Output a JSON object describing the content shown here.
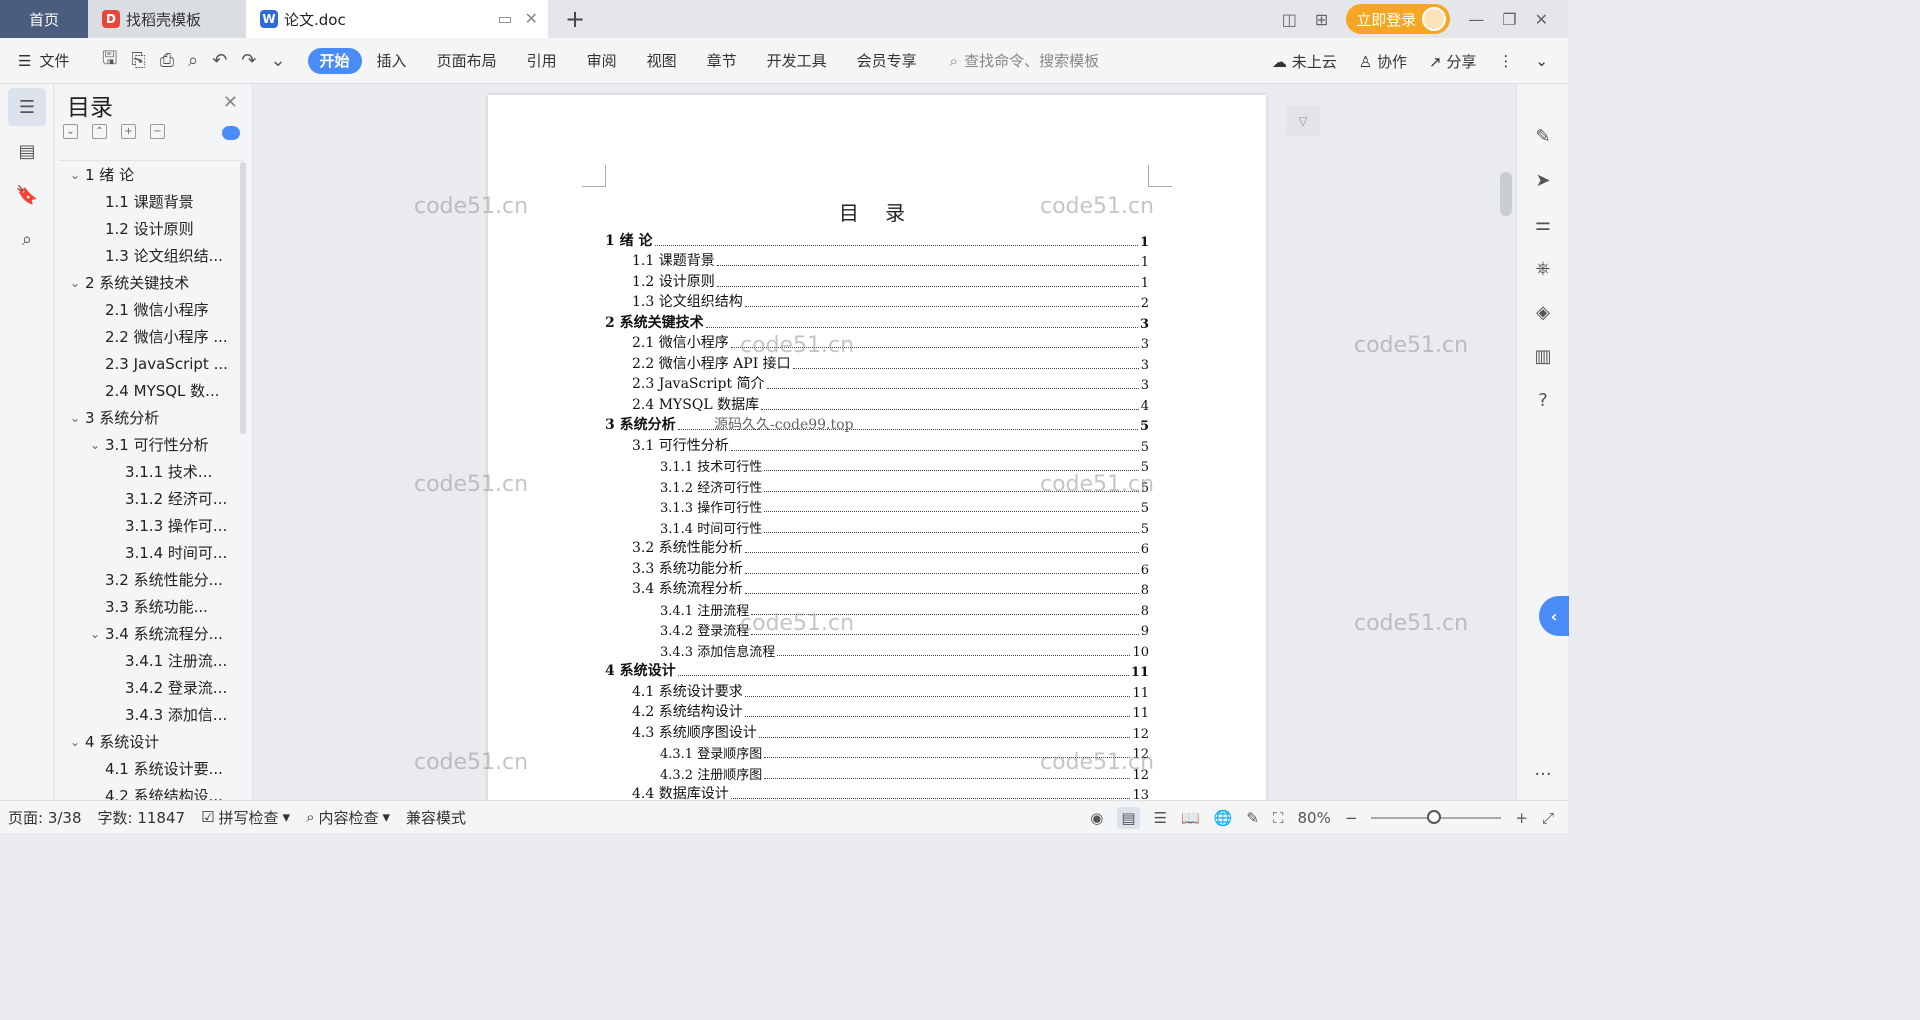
{
  "titlebar": {
    "tabs": [
      {
        "label": "首页"
      },
      {
        "label": "找稻壳模板"
      },
      {
        "label": "论文.doc"
      }
    ],
    "new_tab": "+",
    "login_label": "立即登录"
  },
  "toolbar": {
    "file_label": "文件",
    "tabs": [
      "开始",
      "插入",
      "页面布局",
      "引用",
      "审阅",
      "视图",
      "章节",
      "开发工具",
      "会员专享"
    ],
    "search_placeholder": "查找命令、搜索模板",
    "cloud_label": "未上云",
    "collab_label": "协作",
    "share_label": "分享"
  },
  "toc_panel": {
    "title": "目录",
    "items": [
      {
        "label": "1 绪  论",
        "level": 1,
        "expand": true
      },
      {
        "label": "1.1 课题背景",
        "level": 2
      },
      {
        "label": "1.2 设计原则",
        "level": 2
      },
      {
        "label": "1.3 论文组织结...",
        "level": 2
      },
      {
        "label": "2 系统关键技术",
        "level": 1,
        "expand": true
      },
      {
        "label": "2.1 微信小程序",
        "level": 2
      },
      {
        "label": "2.2 微信小程序 ...",
        "level": 2
      },
      {
        "label": "2.3 JavaScript ...",
        "level": 2
      },
      {
        "label": "2.4 MYSQL 数...",
        "level": 2
      },
      {
        "label": "3 系统分析",
        "level": 1,
        "expand": true
      },
      {
        "label": "3.1 可行性分析",
        "level": 2,
        "expand": true
      },
      {
        "label": "3.1.1  技术...",
        "level": 3
      },
      {
        "label": "3.1.2 经济可...",
        "level": 3
      },
      {
        "label": "3.1.3 操作可...",
        "level": 3
      },
      {
        "label": "3.1.4 时间可...",
        "level": 3
      },
      {
        "label": "3.2 系统性能分...",
        "level": 2
      },
      {
        "label": "3.3   系统功能...",
        "level": 2
      },
      {
        "label": "3.4 系统流程分...",
        "level": 2,
        "expand": true
      },
      {
        "label": "3.4.1 注册流...",
        "level": 3
      },
      {
        "label": "3.4.2 登录流...",
        "level": 3
      },
      {
        "label": "3.4.3 添加信...",
        "level": 3
      },
      {
        "label": "4 系统设计",
        "level": 1,
        "expand": true
      },
      {
        "label": "4.1 系统设计要...",
        "level": 2
      },
      {
        "label": "4.2 系统结构设...",
        "level": 2
      }
    ]
  },
  "document": {
    "title": "目  录",
    "entries": [
      {
        "label": "1 绪  论",
        "page": "1",
        "level": 1
      },
      {
        "label": "1.1 课题背景",
        "page": "1",
        "level": 2
      },
      {
        "label": "1.2 设计原则",
        "page": "1",
        "level": 2
      },
      {
        "label": "1.3 论文组织结构",
        "page": "2",
        "level": 2
      },
      {
        "label": "2 系统关键技术",
        "page": "3",
        "level": 1
      },
      {
        "label": "2.1 微信小程序",
        "page": "3",
        "level": 2
      },
      {
        "label": "2.2 微信小程序 API 接口",
        "page": "3",
        "level": 2
      },
      {
        "label": "2.3  JavaScript 简介",
        "page": "3",
        "level": 2
      },
      {
        "label": "2.4  MYSQL 数据库",
        "page": "4",
        "level": 2
      },
      {
        "label": "3 系统分析",
        "page": "5",
        "level": 1
      },
      {
        "label": "3.1 可行性分析",
        "page": "5",
        "level": 2
      },
      {
        "label": "3.1.1  技术可行性",
        "page": "5",
        "level": 3
      },
      {
        "label": "3.1.2 经济可行性",
        "page": "5",
        "level": 3
      },
      {
        "label": "3.1.3 操作可行性",
        "page": "5",
        "level": 3
      },
      {
        "label": "3.1.4 时间可行性",
        "page": "5",
        "level": 3
      },
      {
        "label": "3.2 系统性能分析",
        "page": "6",
        "level": 2
      },
      {
        "label": "3.3   系统功能分析",
        "page": "6",
        "level": 2
      },
      {
        "label": "3.4 系统流程分析",
        "page": "8",
        "level": 2
      },
      {
        "label": "3.4.1 注册流程",
        "page": "8",
        "level": 3
      },
      {
        "label": "3.4.2 登录流程",
        "page": "9",
        "level": 3
      },
      {
        "label": "3.4.3 添加信息流程",
        "page": "10",
        "level": 3
      },
      {
        "label": "4 系统设计",
        "page": "11",
        "level": 1
      },
      {
        "label": "4.1 系统设计要求",
        "page": "11",
        "level": 2
      },
      {
        "label": "4.2 系统结构设计",
        "page": "11",
        "level": 2
      },
      {
        "label": "4.3 系统顺序图设计",
        "page": "12",
        "level": 2
      },
      {
        "label": "4.3.1  登录顺序图",
        "page": "12",
        "level": 3
      },
      {
        "label": "4.3.2  注册顺序图",
        "page": "12",
        "level": 3
      },
      {
        "label": "4.4 数据库设计",
        "page": "13",
        "level": 2
      }
    ],
    "watermark_text": "code51.cn",
    "stamp_text": "源码久久-code99.top"
  },
  "statusbar": {
    "page_info": "页面: 3/38",
    "word_count": "字数: 11847",
    "spell_check": "拼写检查",
    "content_check": "内容检查",
    "compat_mode": "兼容模式",
    "zoom": "80%"
  },
  "colors": {
    "accent": "#4a8cf7",
    "home_tab": "#4a5d7e",
    "login": "#f5a623"
  }
}
